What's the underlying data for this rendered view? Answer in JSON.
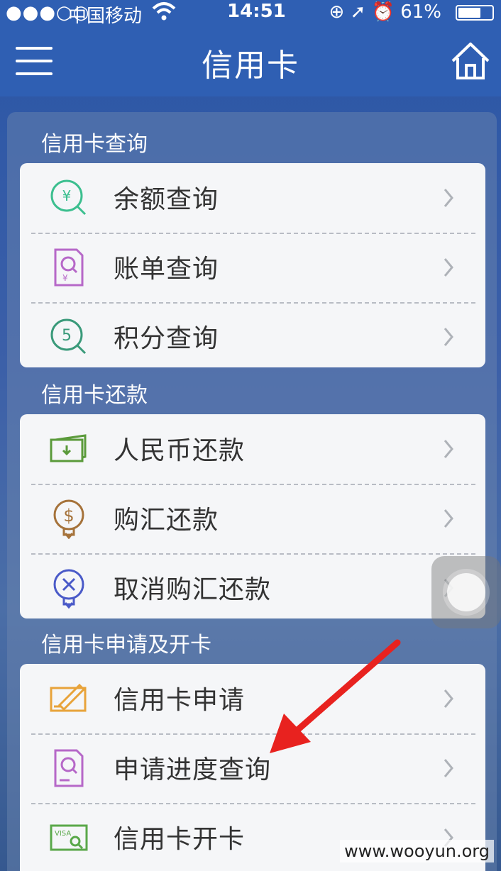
{
  "status_bar": {
    "signal": "●●●○○",
    "carrier": "中国移动",
    "wifi": "wifi-icon",
    "time": "14:51",
    "indicators": "⊕ ➚ ⏰",
    "battery": "61%"
  },
  "nav": {
    "title": "信用卡",
    "menu_icon": "menu-icon",
    "home_icon": "home-icon"
  },
  "sections": [
    {
      "title": "信用卡查询",
      "items": [
        {
          "label": "余额查询",
          "icon": "balance-search-icon",
          "color": "#3cbf8f"
        },
        {
          "label": "账单查询",
          "icon": "bill-search-icon",
          "color": "#b668c8"
        },
        {
          "label": "积分查询",
          "icon": "points-search-icon",
          "color": "#3a9a7a"
        }
      ]
    },
    {
      "title": "信用卡还款",
      "items": [
        {
          "label": "人民币还款",
          "icon": "rmb-repay-icon",
          "color": "#5a9a3a"
        },
        {
          "label": "购汇还款",
          "icon": "exchange-repay-icon",
          "color": "#a5723a"
        },
        {
          "label": "取消购汇还款",
          "icon": "cancel-exchange-icon",
          "color": "#4a5ac8"
        }
      ]
    },
    {
      "title": "信用卡申请及开卡",
      "items": [
        {
          "label": "信用卡申请",
          "icon": "card-apply-icon",
          "color": "#e8a33a"
        },
        {
          "label": "申请进度查询",
          "icon": "progress-search-icon",
          "color": "#b668c8"
        },
        {
          "label": "信用卡开卡",
          "icon": "card-activate-icon",
          "color": "#5aa84a"
        }
      ]
    }
  ],
  "watermark": "www.wooyun.org"
}
